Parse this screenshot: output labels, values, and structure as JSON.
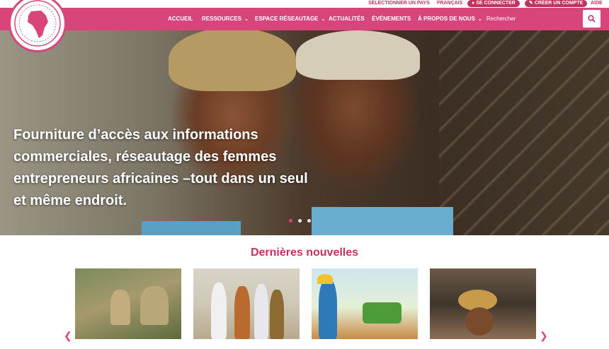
{
  "topbar": {
    "select_country": "SÉLECTIONNER UN PAYS",
    "language": "FRANÇAIS",
    "login": "SE CONNECTER",
    "create_account": "CRÉER UN COMPTE",
    "help": "AIDE"
  },
  "nav": {
    "home": "ACCUEIL",
    "resources": "RESSOURCES",
    "networking": "ESPACE RÉSEAUTAGE",
    "news": "ACTUALITÉS",
    "events": "ÉVÉNEMENTS",
    "about": "À PROPOS DE NOUS",
    "search_label": "Rechercher"
  },
  "hero": {
    "headline": "Fourniture d’accès aux informations commerciales, réseautage des femmes entrepreneurs africaines –tout dans un seul et même endroit.",
    "slide_count": 3,
    "active_slide": 1
  },
  "news": {
    "title": "Dernières nouvelles",
    "cards": [
      {
        "icon": "photo-market-produce"
      },
      {
        "icon": "photo-ceremony-group"
      },
      {
        "icon": "illustration-farmer-tractor"
      },
      {
        "icon": "photo-woman-headwrap"
      }
    ]
  },
  "colors": {
    "brand_pink": "#d8457a",
    "brand_dark_pink": "#c0335f",
    "white": "#ffffff"
  },
  "icons": {
    "search": "search-icon",
    "prev": "chevron-left-icon",
    "next": "chevron-right-icon",
    "login": "user-icon",
    "create": "pencil-icon",
    "logo": "africa-map-logo"
  }
}
